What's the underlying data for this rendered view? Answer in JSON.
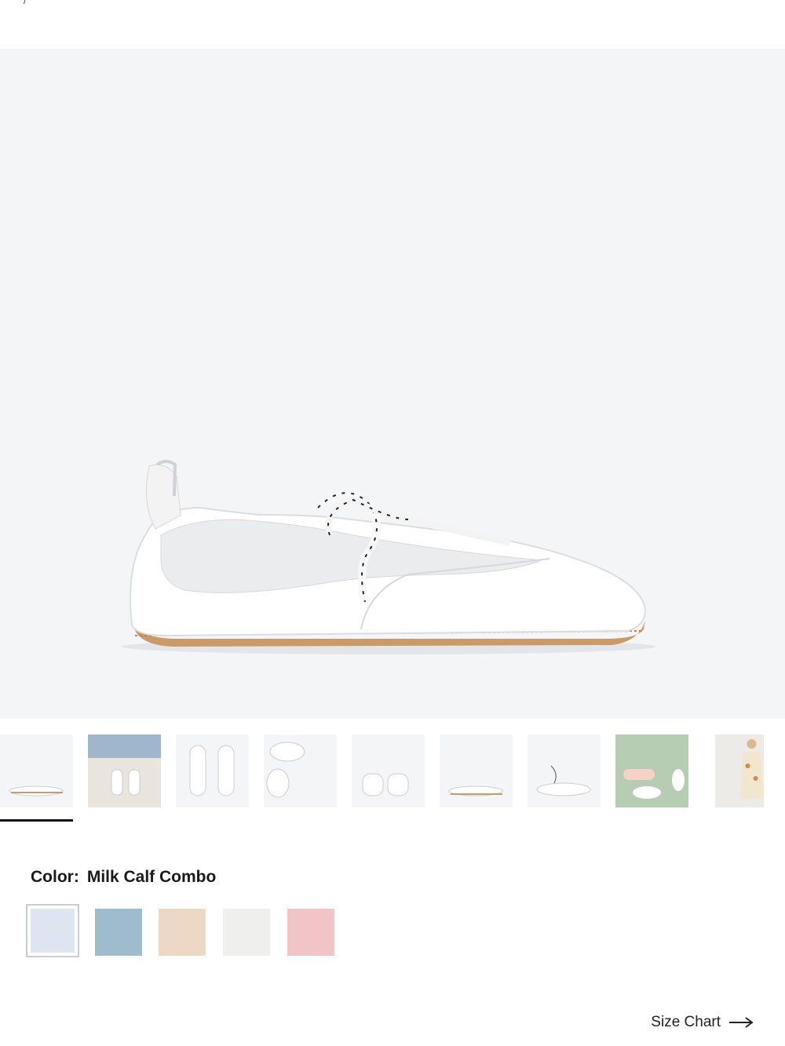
{
  "top_crumb": "/",
  "product": {
    "main_image_alt": "White leather and suede lace-up sneaker",
    "thumbnails": [
      {
        "alt": "side view",
        "selected": true
      },
      {
        "alt": "model tying laces"
      },
      {
        "alt": "top view pair"
      },
      {
        "alt": "pair on angle"
      },
      {
        "alt": "heel view pair"
      },
      {
        "alt": "side view"
      },
      {
        "alt": "laces wrapped"
      },
      {
        "alt": "model legs"
      },
      {
        "alt": "model full body"
      }
    ]
  },
  "color": {
    "label": "Color:",
    "value": "Milk Calf Combo",
    "swatches": [
      {
        "name": "Milk Calf Combo",
        "color": "#dfe4f1",
        "selected": true
      },
      {
        "name": "Denim",
        "color": "#9ebccb"
      },
      {
        "name": "Tan",
        "color": "#ecd8c4"
      },
      {
        "name": "White",
        "color": "#efefee"
      },
      {
        "name": "Pink",
        "color": "#f1c5c8"
      }
    ]
  },
  "size_chart": {
    "label": "Size Chart"
  },
  "colors": {
    "hero_bg": "#f4f5f7",
    "sole": "#c99a6a",
    "text": "#1a1a1a"
  }
}
